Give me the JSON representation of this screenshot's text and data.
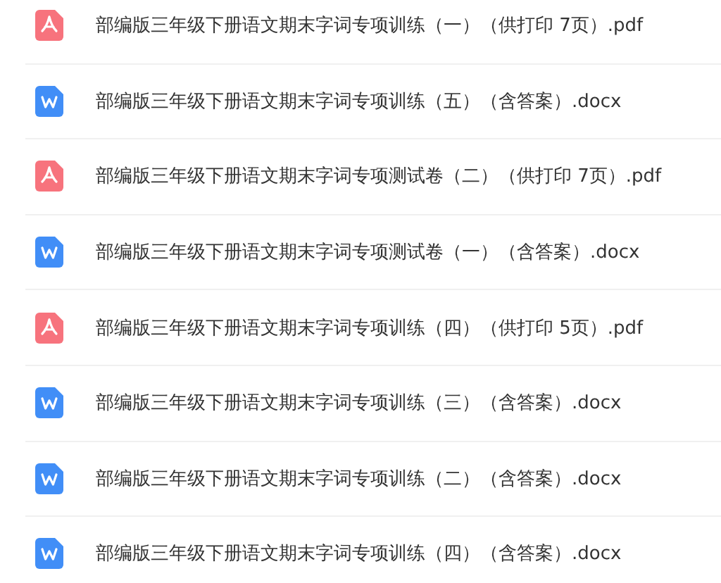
{
  "files": [
    {
      "kind": "pdf",
      "name": "部编版三年级下册语文期末字词专项训练（一）（供打印 7页）.pdf"
    },
    {
      "kind": "word",
      "name": "部编版三年级下册语文期末字词专项训练（五）（含答案）.docx"
    },
    {
      "kind": "pdf",
      "name": "部编版三年级下册语文期末字词专项测试卷（二）（供打印 7页）.pdf"
    },
    {
      "kind": "word",
      "name": "部编版三年级下册语文期末字词专项测试卷（一）（含答案）.docx"
    },
    {
      "kind": "pdf",
      "name": "部编版三年级下册语文期末字词专项训练（四）（供打印 5页）.pdf"
    },
    {
      "kind": "word",
      "name": "部编版三年级下册语文期末字词专项训练（三）（含答案）.docx"
    },
    {
      "kind": "word",
      "name": "部编版三年级下册语文期末字词专项训练（二）（含答案）.docx"
    },
    {
      "kind": "word",
      "name": "部编版三年级下册语文期末字词专项训练（四）（含答案）.docx"
    }
  ]
}
